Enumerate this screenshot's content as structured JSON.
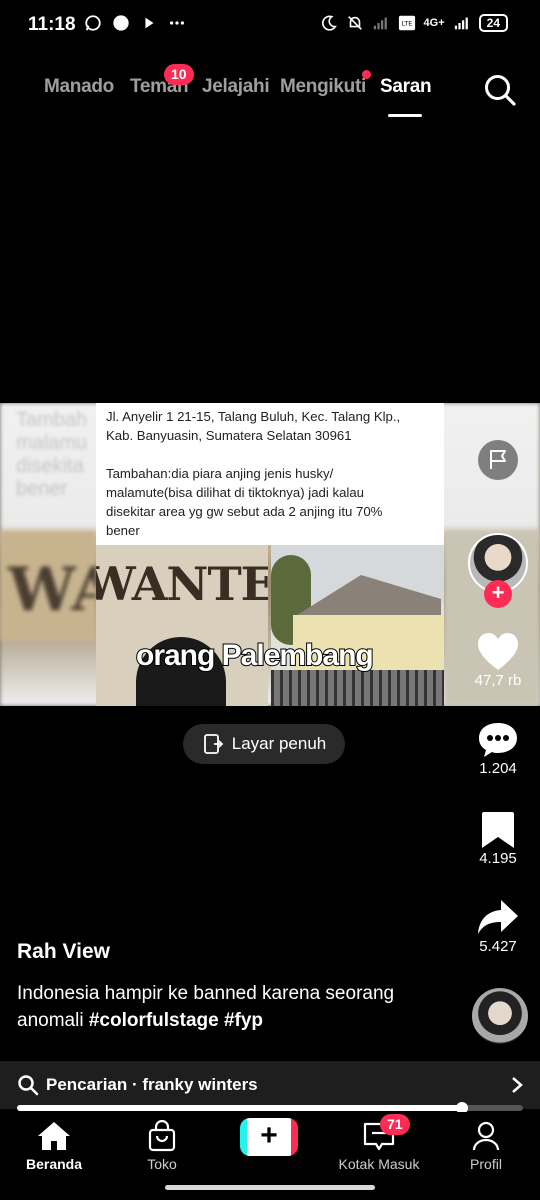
{
  "status_bar": {
    "time": "11:18",
    "battery": "24",
    "network": "4G+"
  },
  "top_nav": {
    "tabs": [
      {
        "label": "Manado"
      },
      {
        "label": "Teman",
        "badge": "10"
      },
      {
        "label": "Jelajahi"
      },
      {
        "label": "Mengikuti",
        "dot": true
      },
      {
        "label": "Saran",
        "active": true
      }
    ]
  },
  "video": {
    "card_text": "Jl. Anyelir 1 21-15, Talang Buluh, Kec. Talang Klp.,\nKab. Banyuasin, Sumatera Selatan 30961\n\nTambahan:dia piara anjing jenis husky/\nmalamute(bisa dilihat di tiktoknya) jadi kalau\ndisekitar area yg gw sebut ada 2 anjing itu 70%\nbener",
    "blur_text": "Tambah\nmalamu\ndisekita\nbener",
    "sign_text": "WANTEI",
    "overlay_caption": "orang Palembang"
  },
  "actions": {
    "likes": "47,7 rb",
    "comments": "1.204",
    "bookmarks": "4.195",
    "shares": "5.427"
  },
  "fullscreen_label": "Layar penuh",
  "post": {
    "author": "Rah View",
    "description": "Indonesia hampir ke banned karena seorang anomali ",
    "hashtags": "#colorfulstage #fyp"
  },
  "search_bar": {
    "text": "Pencarian · franky winters"
  },
  "playback": {
    "progress": 0.88
  },
  "bottom_nav": {
    "items": [
      {
        "label": "Beranda",
        "active": true
      },
      {
        "label": "Toko"
      },
      {
        "label": "Kotak Masuk",
        "badge": "71"
      },
      {
        "label": "Profil"
      }
    ]
  },
  "colors": {
    "accent": "#fe2c55",
    "cyan": "#25f4ee"
  }
}
